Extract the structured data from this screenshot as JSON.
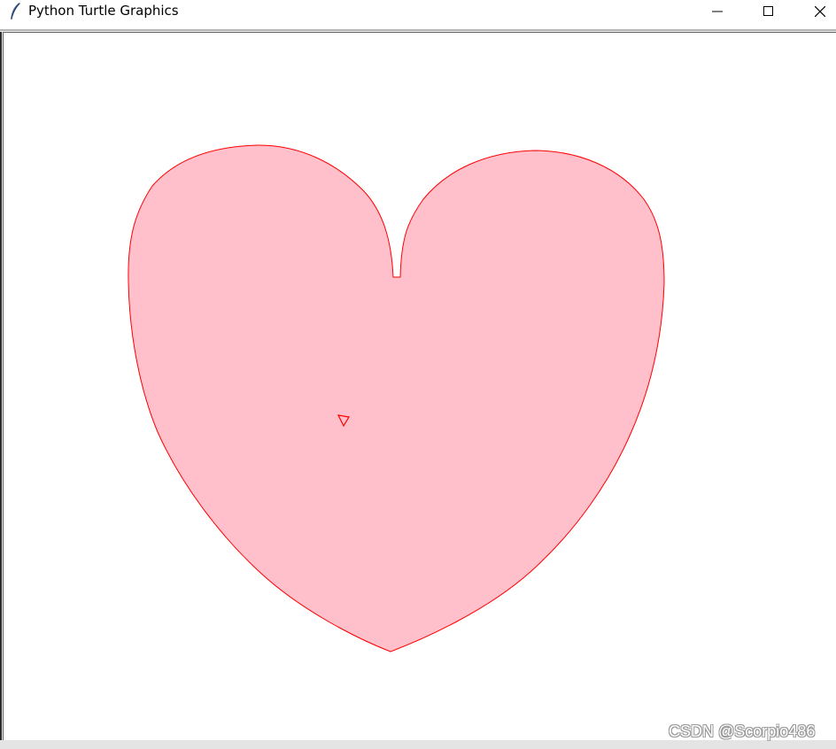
{
  "window": {
    "title": "Python Turtle Graphics",
    "icon": "feather-icon"
  },
  "controls": {
    "minimize_icon": "minimize-icon",
    "maximize_icon": "maximize-icon",
    "close_icon": "close-icon"
  },
  "drawing": {
    "shape": "heart",
    "fill_color": "#ffc0cb",
    "outline_color": "#ff0000",
    "turtle_color": "#ff0000"
  },
  "watermark": {
    "text": "CSDN @Scorpio486"
  }
}
